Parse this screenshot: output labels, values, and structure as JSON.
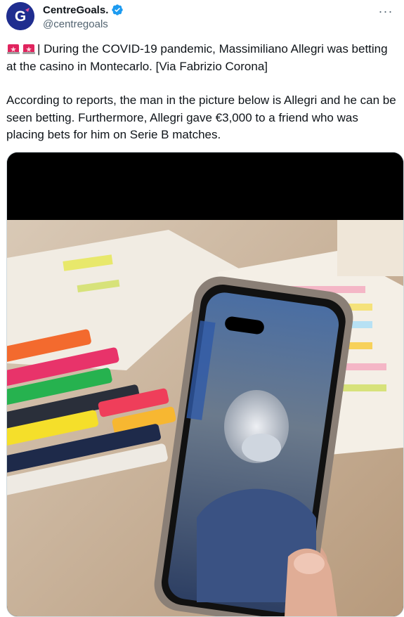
{
  "author": {
    "display_name": "CentreGoals.",
    "handle": "@centregoals",
    "avatar_letter": "G",
    "avatar_color": "#1d2a8a",
    "verified": true,
    "verified_color": "#1d9bf0"
  },
  "more_icon": "ellipsis-icon",
  "tweet": {
    "emoji_icon": "police-light-icon",
    "line1": "| During the COVID-19 pandemic, Massimiliano Allegri was betting at the casino in Montecarlo. [Via Fabrizio Corona]",
    "line2": "According to reports, the man in the picture below is Allegri and he can be seen betting. Furthermore, Allegri gave €3,000 to a friend who was placing bets for him on Serie B matches."
  },
  "media": {
    "type": "video-still",
    "subject": "phone held in hand over table with colored markers and notes"
  },
  "colors": {
    "text_primary": "#0f1419",
    "text_secondary": "#536471",
    "border": "#cfd9de"
  }
}
